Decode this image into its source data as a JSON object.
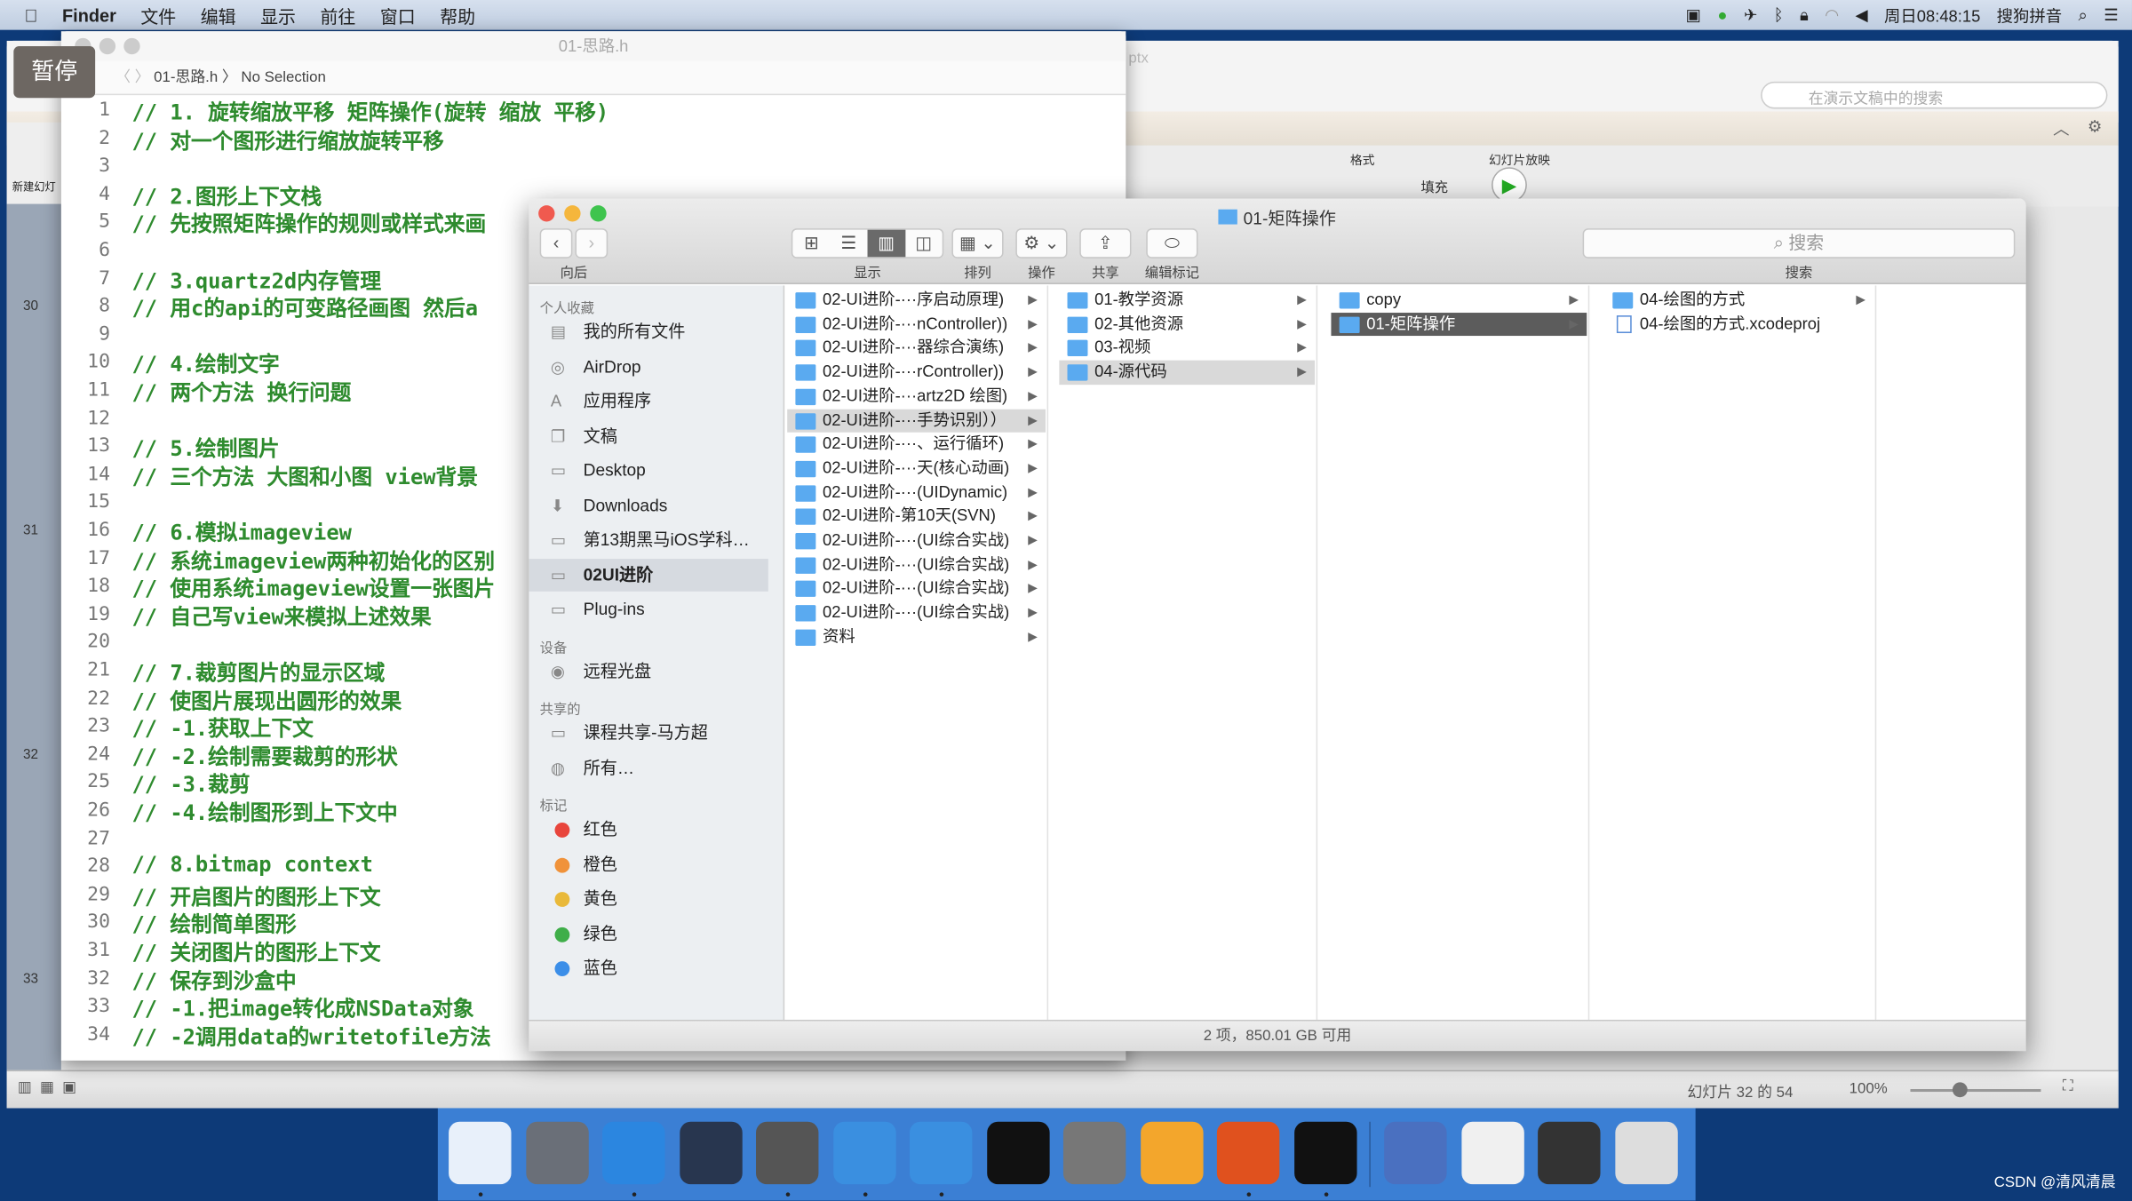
{
  "menubar": {
    "app": "Finder",
    "items": [
      "文件",
      "编辑",
      "显示",
      "前往",
      "窗口",
      "帮助"
    ],
    "clock": "周日08:48:15",
    "ime": "搜狗拼音"
  },
  "keynote": {
    "search_placeholder": "在演示文稿中的搜索",
    "ribbon_format": "格式",
    "ribbon_slideshow": "幻灯片放映",
    "fill_label": "填充",
    "new_slide": "新建幻灯",
    "slide_numbers": [
      "30",
      "31",
      "32",
      "33"
    ],
    "status_slide": "幻灯片 32 的 54",
    "zoom": "100%",
    "title_fragment": "ptx"
  },
  "pause_button": "暂停",
  "xcode": {
    "title": "01-思路.h",
    "path_file": "01-思路.h",
    "path_selection": "No Selection",
    "lines": [
      "// 1.  旋转缩放平移 矩阵操作(旋转 缩放 平移)",
      "// 对一个图形进行缩放旋转平移",
      "",
      "// 2.图形上下文栈",
      "// 先按照矩阵操作的规则或样式来画",
      "",
      "// 3.quartz2d内存管理",
      "// 用c的api的可变路径画图 然后a",
      "",
      "// 4.绘制文字",
      "// 两个方法 换行问题",
      "",
      "// 5.绘制图片",
      "// 三个方法 大图和小图 view背景",
      "",
      "// 6.模拟imageview",
      "// 系统imageview两种初始化的区别",
      "// 使用系统imageview设置一张图片",
      "// 自己写view来模拟上述效果",
      "",
      "// 7.裁剪图片的显示区域",
      "// 使图片展现出圆形的效果",
      "// -1.获取上下文",
      "// -2.绘制需要裁剪的形状",
      "// -3.裁剪",
      "// -4.绘制图形到上下文中",
      "",
      "// 8.bitmap context",
      "// 开启图片的图形上下文",
      "// 绘制简单图形",
      "// 关闭图片的图形上下文",
      "// 保存到沙盒中",
      "// -1.把image转化成NSData对象",
      "// -2调用data的writetofile方法"
    ]
  },
  "finder": {
    "title": "01-矩阵操作",
    "toolbar": {
      "back": "向后",
      "view": "显示",
      "arrange": "排列",
      "action": "操作",
      "share": "共享",
      "tags": "编辑标记",
      "search_placeholder": "搜索",
      "search_label": "搜索"
    },
    "sidebar": {
      "favorites_header": "个人收藏",
      "favorites": [
        {
          "label": "我的所有文件",
          "icon": "all-files-icon"
        },
        {
          "label": "AirDrop",
          "icon": "airdrop-icon"
        },
        {
          "label": "应用程序",
          "icon": "applications-icon"
        },
        {
          "label": "文稿",
          "icon": "documents-icon"
        },
        {
          "label": "Desktop",
          "icon": "desktop-icon"
        },
        {
          "label": "Downloads",
          "icon": "downloads-icon"
        },
        {
          "label": "第13期黑马iOS学科…",
          "icon": "folder-icon"
        },
        {
          "label": "02UI进阶",
          "icon": "folder-icon"
        },
        {
          "label": "Plug-ins",
          "icon": "folder-icon"
        }
      ],
      "devices_header": "设备",
      "devices": [
        {
          "label": "远程光盘",
          "icon": "disc-icon"
        }
      ],
      "shared_header": "共享的",
      "shared": [
        {
          "label": "课程共享-马方超",
          "icon": "computer-icon"
        },
        {
          "label": "所有…",
          "icon": "network-icon"
        }
      ],
      "tags_header": "标记",
      "tags": [
        {
          "label": "红色",
          "color": "#e8453c"
        },
        {
          "label": "橙色",
          "color": "#f0923a"
        },
        {
          "label": "黄色",
          "color": "#e9b93a"
        },
        {
          "label": "绿色",
          "color": "#3fae49"
        },
        {
          "label": "蓝色",
          "color": "#3b8ee8"
        }
      ]
    },
    "columns": [
      [
        "02-UI进阶-···序启动原理)",
        "02-UI进阶-···nController))",
        "02-UI进阶-···器综合演练)",
        "02-UI进阶-···rController))",
        "02-UI进阶-···artz2D 绘图)",
        "02-UI进阶-···手势识别））",
        "02-UI进阶-···、运行循环)",
        "02-UI进阶-···天(核心动画)",
        "02-UI进阶-···(UIDynamic)",
        "02-UI进阶-第10天(SVN)",
        "02-UI进阶-···(UI综合实战)",
        "02-UI进阶-···(UI综合实战)",
        "02-UI进阶-···(UI综合实战)",
        "02-UI进阶-···(UI综合实战)",
        "资料"
      ],
      [
        "01-教学资源",
        "02-其他资源",
        "03-视频",
        "04-源代码"
      ],
      [
        "copy",
        "01-矩阵操作"
      ],
      [
        "04-绘图的方式",
        "04-绘图的方式.xcodeproj"
      ]
    ],
    "status": "2 项，850.01 GB 可用"
  },
  "dock": [
    "finder-icon",
    "launchpad-icon",
    "safari-icon",
    "mouse-app-icon",
    "imovie-icon",
    "xcode-icon",
    "instruments-icon",
    "terminal-icon",
    "system-preferences-icon",
    "sketch-icon",
    "powerpoint-icon",
    "exec-terminal-icon",
    "quicktime-icon",
    "preview-icon",
    "screen-sharing-icon",
    "trash-icon"
  ],
  "watermark": "CSDN @清风清晨"
}
